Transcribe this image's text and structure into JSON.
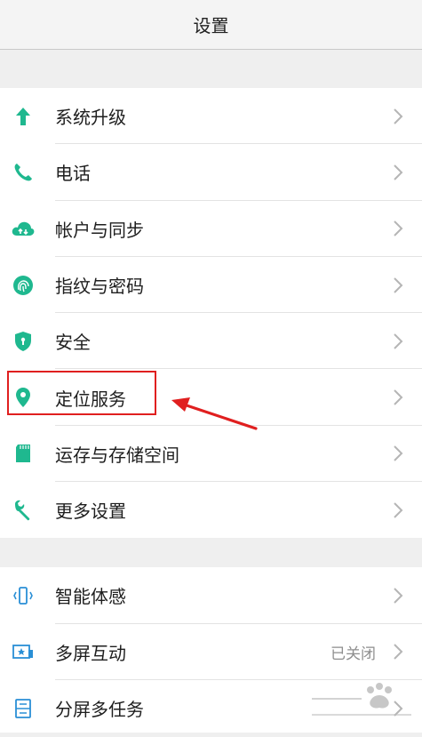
{
  "header": {
    "title": "设置"
  },
  "group1": [
    {
      "label": "系统升级",
      "icon": "arrow-up-icon"
    },
    {
      "label": "电话",
      "icon": "phone-icon"
    },
    {
      "label": "帐户与同步",
      "icon": "cloud-sync-icon"
    },
    {
      "label": "指纹与密码",
      "icon": "fingerprint-icon"
    },
    {
      "label": "安全",
      "icon": "shield-icon"
    },
    {
      "label": "定位服务",
      "icon": "location-pin-icon"
    },
    {
      "label": "运存与存储空间",
      "icon": "sd-card-icon"
    },
    {
      "label": "更多设置",
      "icon": "wrench-icon"
    }
  ],
  "group2": [
    {
      "label": "智能体感",
      "icon": "phone-vibrate-icon",
      "value": ""
    },
    {
      "label": "多屏互动",
      "icon": "screen-share-icon",
      "value": "已关闭"
    },
    {
      "label": "分屏多任务",
      "icon": "split-screen-icon",
      "value": ""
    }
  ],
  "colors": {
    "accent": "#1fb88f",
    "annotation": "#e01f1f"
  }
}
